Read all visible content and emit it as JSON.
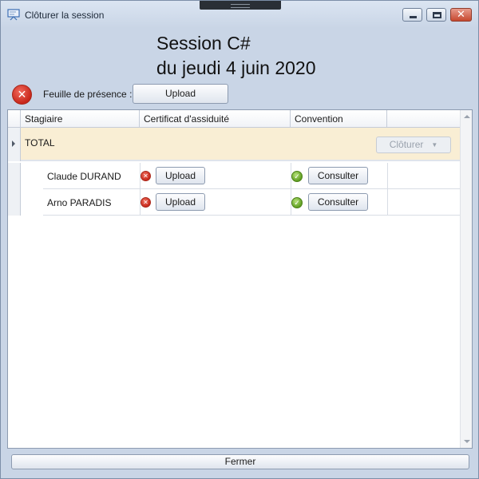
{
  "window": {
    "title": "Clôturer la session",
    "icon": "presentation-board-icon"
  },
  "header": {
    "session_title": "Session C#",
    "session_date": "du jeudi 4 juin 2020",
    "presence_label": "Feuille de présence :",
    "presence_status_icon": "error-icon",
    "presence_upload_label": "Upload"
  },
  "grid": {
    "columns": [
      "Stagiaire",
      "Certificat d'assiduité",
      "Convention",
      ""
    ],
    "group": {
      "label": "TOTAL",
      "action_label": "Clôturer"
    },
    "rows": [
      {
        "name": "Claude DURAND",
        "certificat_status": "error",
        "certificat_button": "Upload",
        "convention_status": "ok",
        "convention_button": "Consulter"
      },
      {
        "name": "Arno PARADIS",
        "certificat_status": "error",
        "certificat_button": "Upload",
        "convention_status": "ok",
        "convention_button": "Consulter"
      }
    ]
  },
  "footer": {
    "close_label": "Fermer"
  },
  "colors": {
    "window_bg": "#c9d5e6",
    "group_row_bg": "#f9eed4",
    "error": "#c8271b",
    "ok": "#5f9e22"
  }
}
